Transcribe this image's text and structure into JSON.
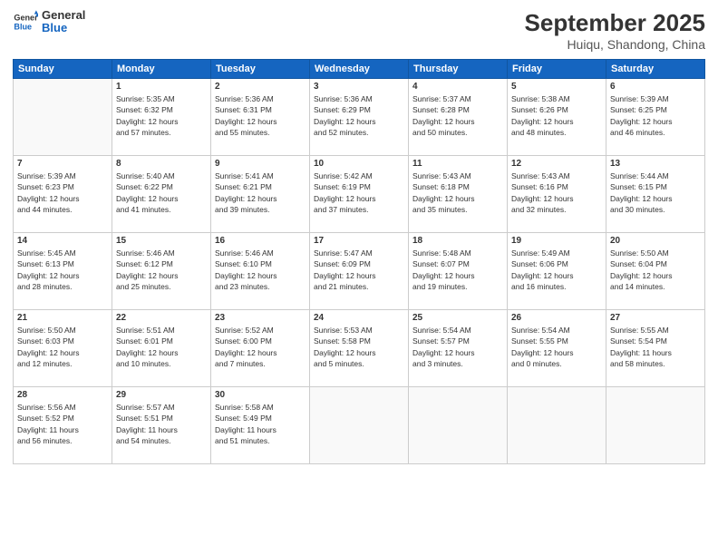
{
  "header": {
    "logo_line1": "General",
    "logo_line2": "Blue",
    "title": "September 2025",
    "subtitle": "Huiqu, Shandong, China"
  },
  "days_of_week": [
    "Sunday",
    "Monday",
    "Tuesday",
    "Wednesday",
    "Thursday",
    "Friday",
    "Saturday"
  ],
  "weeks": [
    [
      {
        "day": "",
        "info": ""
      },
      {
        "day": "1",
        "info": "Sunrise: 5:35 AM\nSunset: 6:32 PM\nDaylight: 12 hours\nand 57 minutes."
      },
      {
        "day": "2",
        "info": "Sunrise: 5:36 AM\nSunset: 6:31 PM\nDaylight: 12 hours\nand 55 minutes."
      },
      {
        "day": "3",
        "info": "Sunrise: 5:36 AM\nSunset: 6:29 PM\nDaylight: 12 hours\nand 52 minutes."
      },
      {
        "day": "4",
        "info": "Sunrise: 5:37 AM\nSunset: 6:28 PM\nDaylight: 12 hours\nand 50 minutes."
      },
      {
        "day": "5",
        "info": "Sunrise: 5:38 AM\nSunset: 6:26 PM\nDaylight: 12 hours\nand 48 minutes."
      },
      {
        "day": "6",
        "info": "Sunrise: 5:39 AM\nSunset: 6:25 PM\nDaylight: 12 hours\nand 46 minutes."
      }
    ],
    [
      {
        "day": "7",
        "info": "Sunrise: 5:39 AM\nSunset: 6:23 PM\nDaylight: 12 hours\nand 44 minutes."
      },
      {
        "day": "8",
        "info": "Sunrise: 5:40 AM\nSunset: 6:22 PM\nDaylight: 12 hours\nand 41 minutes."
      },
      {
        "day": "9",
        "info": "Sunrise: 5:41 AM\nSunset: 6:21 PM\nDaylight: 12 hours\nand 39 minutes."
      },
      {
        "day": "10",
        "info": "Sunrise: 5:42 AM\nSunset: 6:19 PM\nDaylight: 12 hours\nand 37 minutes."
      },
      {
        "day": "11",
        "info": "Sunrise: 5:43 AM\nSunset: 6:18 PM\nDaylight: 12 hours\nand 35 minutes."
      },
      {
        "day": "12",
        "info": "Sunrise: 5:43 AM\nSunset: 6:16 PM\nDaylight: 12 hours\nand 32 minutes."
      },
      {
        "day": "13",
        "info": "Sunrise: 5:44 AM\nSunset: 6:15 PM\nDaylight: 12 hours\nand 30 minutes."
      }
    ],
    [
      {
        "day": "14",
        "info": "Sunrise: 5:45 AM\nSunset: 6:13 PM\nDaylight: 12 hours\nand 28 minutes."
      },
      {
        "day": "15",
        "info": "Sunrise: 5:46 AM\nSunset: 6:12 PM\nDaylight: 12 hours\nand 25 minutes."
      },
      {
        "day": "16",
        "info": "Sunrise: 5:46 AM\nSunset: 6:10 PM\nDaylight: 12 hours\nand 23 minutes."
      },
      {
        "day": "17",
        "info": "Sunrise: 5:47 AM\nSunset: 6:09 PM\nDaylight: 12 hours\nand 21 minutes."
      },
      {
        "day": "18",
        "info": "Sunrise: 5:48 AM\nSunset: 6:07 PM\nDaylight: 12 hours\nand 19 minutes."
      },
      {
        "day": "19",
        "info": "Sunrise: 5:49 AM\nSunset: 6:06 PM\nDaylight: 12 hours\nand 16 minutes."
      },
      {
        "day": "20",
        "info": "Sunrise: 5:50 AM\nSunset: 6:04 PM\nDaylight: 12 hours\nand 14 minutes."
      }
    ],
    [
      {
        "day": "21",
        "info": "Sunrise: 5:50 AM\nSunset: 6:03 PM\nDaylight: 12 hours\nand 12 minutes."
      },
      {
        "day": "22",
        "info": "Sunrise: 5:51 AM\nSunset: 6:01 PM\nDaylight: 12 hours\nand 10 minutes."
      },
      {
        "day": "23",
        "info": "Sunrise: 5:52 AM\nSunset: 6:00 PM\nDaylight: 12 hours\nand 7 minutes."
      },
      {
        "day": "24",
        "info": "Sunrise: 5:53 AM\nSunset: 5:58 PM\nDaylight: 12 hours\nand 5 minutes."
      },
      {
        "day": "25",
        "info": "Sunrise: 5:54 AM\nSunset: 5:57 PM\nDaylight: 12 hours\nand 3 minutes."
      },
      {
        "day": "26",
        "info": "Sunrise: 5:54 AM\nSunset: 5:55 PM\nDaylight: 12 hours\nand 0 minutes."
      },
      {
        "day": "27",
        "info": "Sunrise: 5:55 AM\nSunset: 5:54 PM\nDaylight: 11 hours\nand 58 minutes."
      }
    ],
    [
      {
        "day": "28",
        "info": "Sunrise: 5:56 AM\nSunset: 5:52 PM\nDaylight: 11 hours\nand 56 minutes."
      },
      {
        "day": "29",
        "info": "Sunrise: 5:57 AM\nSunset: 5:51 PM\nDaylight: 11 hours\nand 54 minutes."
      },
      {
        "day": "30",
        "info": "Sunrise: 5:58 AM\nSunset: 5:49 PM\nDaylight: 11 hours\nand 51 minutes."
      },
      {
        "day": "",
        "info": ""
      },
      {
        "day": "",
        "info": ""
      },
      {
        "day": "",
        "info": ""
      },
      {
        "day": "",
        "info": ""
      }
    ]
  ]
}
